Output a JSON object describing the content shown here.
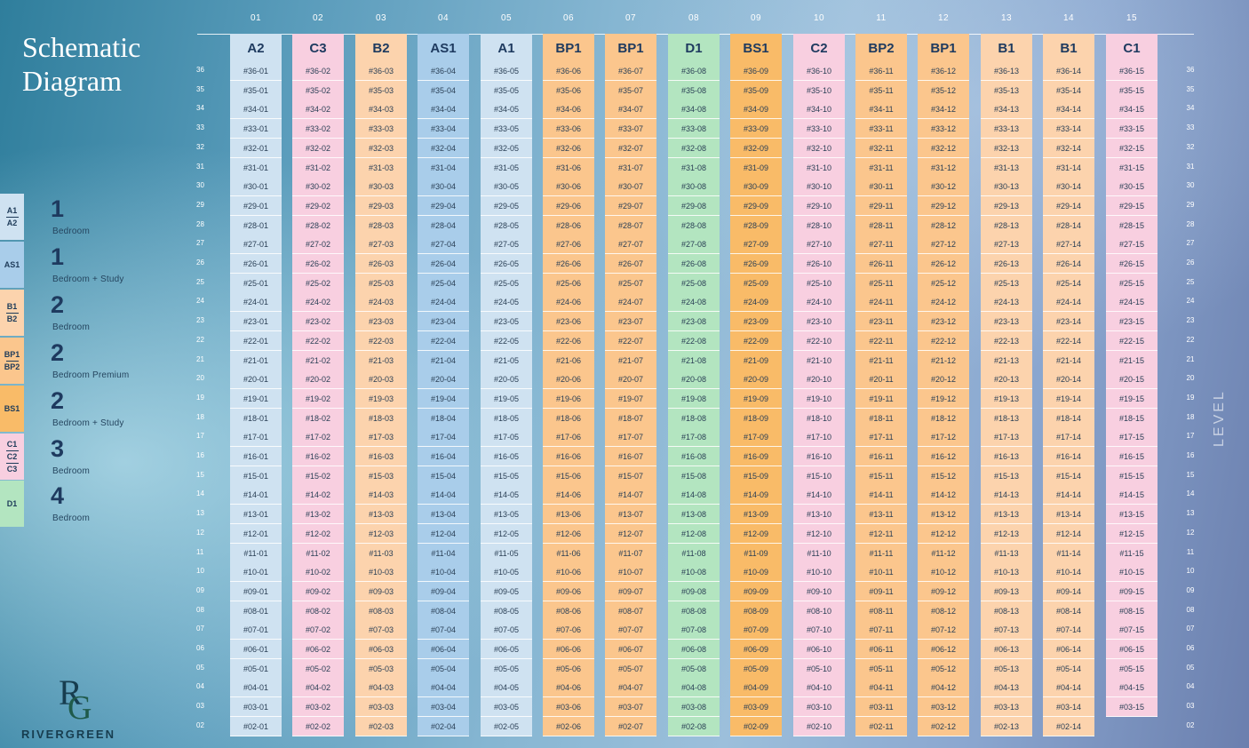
{
  "title": {
    "line1": "Schematic",
    "line2": "Diagram"
  },
  "colors": {
    "A": "#cfe2f1",
    "AS": "#a9cdea",
    "B": "#fcd3ad",
    "BP": "#fbc68d",
    "BS": "#f9bb68",
    "C": "#f8cfe0",
    "D": "#b3e5c0"
  },
  "legend": [
    {
      "codes": [
        "A1",
        "A2"
      ],
      "group": "A",
      "count": "1",
      "desc": "Bedroom"
    },
    {
      "codes": [
        "AS1"
      ],
      "group": "AS",
      "count": "1",
      "desc": "Bedroom + Study"
    },
    {
      "codes": [
        "B1",
        "B2"
      ],
      "group": "B",
      "count": "2",
      "desc": "Bedroom"
    },
    {
      "codes": [
        "BP1",
        "BP2"
      ],
      "group": "BP",
      "count": "2",
      "desc": "Bedroom Premium"
    },
    {
      "codes": [
        "BS1"
      ],
      "group": "BS",
      "count": "2",
      "desc": "Bedroom + Study"
    },
    {
      "codes": [
        "C1",
        "C2",
        "C3"
      ],
      "group": "C",
      "count": "3",
      "desc": "Bedroom"
    },
    {
      "codes": [
        "D1"
      ],
      "group": "D",
      "count": "4",
      "desc": "Bedroom"
    }
  ],
  "columns": [
    {
      "stack": "01",
      "type": "A2",
      "group": "A",
      "units": [
        "#36-01",
        "#35-01",
        "#34-01",
        "#33-01",
        "#32-01",
        "#31-01",
        "#30-01",
        "#29-01",
        "#28-01",
        "#27-01",
        "#26-01",
        "#25-01",
        "#24-01",
        "#23-01",
        "#22-01",
        "#21-01",
        "#20-01",
        "#19-01",
        "#18-01",
        "#17-01",
        "#16-01",
        "#15-01",
        "#14-01",
        "#13-01",
        "#12-01",
        "#11-01",
        "#10-01",
        "#09-01",
        "#08-01",
        "#07-01",
        "#06-01",
        "#05-01",
        "#04-01",
        "#03-01",
        "#02-01"
      ]
    },
    {
      "stack": "02",
      "type": "C3",
      "group": "C",
      "units": [
        "#36-02",
        "#35-02",
        "#34-02",
        "#33-02",
        "#32-02",
        "#31-02",
        "#30-02",
        "#29-02",
        "#28-02",
        "#27-02",
        "#26-02",
        "#25-02",
        "#24-02",
        "#23-02",
        "#22-02",
        "#21-02",
        "#20-02",
        "#19-02",
        "#18-02",
        "#17-02",
        "#16-02",
        "#15-02",
        "#14-02",
        "#13-02",
        "#12-02",
        "#11-02",
        "#10-02",
        "#09-02",
        "#08-02",
        "#07-02",
        "#06-02",
        "#05-02",
        "#04-02",
        "#03-02",
        "#02-02"
      ]
    },
    {
      "stack": "03",
      "type": "B2",
      "group": "B",
      "units": [
        "#36-03",
        "#35-03",
        "#34-03",
        "#33-03",
        "#32-03",
        "#31-03",
        "#30-03",
        "#29-03",
        "#28-03",
        "#27-03",
        "#26-03",
        "#25-03",
        "#24-03",
        "#23-03",
        "#22-03",
        "#21-03",
        "#20-03",
        "#19-03",
        "#18-03",
        "#17-03",
        "#16-03",
        "#15-03",
        "#14-03",
        "#13-03",
        "#12-03",
        "#11-03",
        "#10-03",
        "#09-03",
        "#08-03",
        "#07-03",
        "#06-03",
        "#05-03",
        "#04-03",
        "#03-03",
        "#02-03"
      ]
    },
    {
      "stack": "04",
      "type": "AS1",
      "group": "AS",
      "units": [
        "#36-04",
        "#35-04",
        "#34-04",
        "#33-04",
        "#32-04",
        "#31-04",
        "#30-04",
        "#29-04",
        "#28-04",
        "#27-04",
        "#26-04",
        "#25-04",
        "#24-04",
        "#23-04",
        "#22-04",
        "#21-04",
        "#20-04",
        "#19-04",
        "#18-04",
        "#17-04",
        "#16-04",
        "#15-04",
        "#14-04",
        "#13-04",
        "#12-04",
        "#11-04",
        "#10-04",
        "#09-04",
        "#08-04",
        "#07-04",
        "#06-04",
        "#05-04",
        "#04-04",
        "#03-04",
        "#02-04"
      ]
    },
    {
      "stack": "05",
      "type": "A1",
      "group": "A",
      "units": [
        "#36-05",
        "#35-05",
        "#34-05",
        "#33-05",
        "#32-05",
        "#31-05",
        "#30-05",
        "#29-05",
        "#28-05",
        "#27-05",
        "#26-05",
        "#25-05",
        "#24-05",
        "#23-05",
        "#22-05",
        "#21-05",
        "#20-05",
        "#19-05",
        "#18-05",
        "#17-05",
        "#16-05",
        "#15-05",
        "#14-05",
        "#13-05",
        "#12-05",
        "#11-05",
        "#10-05",
        "#09-05",
        "#08-05",
        "#07-05",
        "#06-05",
        "#05-05",
        "#04-05",
        "#03-05",
        "#02-05"
      ]
    },
    {
      "stack": "06",
      "type": "BP1",
      "group": "BP",
      "units": [
        "#36-06",
        "#35-06",
        "#34-06",
        "#33-06",
        "#32-06",
        "#31-06",
        "#30-06",
        "#29-06",
        "#28-06",
        "#27-06",
        "#26-06",
        "#25-06",
        "#24-06",
        "#23-06",
        "#22-06",
        "#21-06",
        "#20-06",
        "#19-06",
        "#18-06",
        "#17-06",
        "#16-06",
        "#15-06",
        "#14-06",
        "#13-06",
        "#12-06",
        "#11-06",
        "#10-06",
        "#09-06",
        "#08-06",
        "#07-06",
        "#06-06",
        "#05-06",
        "#04-06",
        "#03-06",
        "#02-06"
      ]
    },
    {
      "stack": "07",
      "type": "BP1",
      "group": "BP",
      "units": [
        "#36-07",
        "#35-07",
        "#34-07",
        "#33-07",
        "#32-07",
        "#31-07",
        "#30-07",
        "#29-07",
        "#28-07",
        "#27-07",
        "#26-07",
        "#25-07",
        "#24-07",
        "#23-07",
        "#22-07",
        "#21-07",
        "#20-07",
        "#19-07",
        "#18-07",
        "#17-07",
        "#16-07",
        "#15-07",
        "#14-07",
        "#13-07",
        "#12-07",
        "#11-07",
        "#10-07",
        "#09-07",
        "#08-07",
        "#07-07",
        "#06-07",
        "#05-07",
        "#04-07",
        "#03-07",
        "#02-07"
      ]
    },
    {
      "stack": "08",
      "type": "D1",
      "group": "D",
      "units": [
        "#36-08",
        "#35-08",
        "#34-08",
        "#33-08",
        "#32-08",
        "#31-08",
        "#30-08",
        "#29-08",
        "#28-08",
        "#27-08",
        "#26-08",
        "#25-08",
        "#24-08",
        "#23-08",
        "#22-08",
        "#21-08",
        "#20-08",
        "#19-08",
        "#18-08",
        "#17-08",
        "#16-08",
        "#15-08",
        "#14-08",
        "#13-08",
        "#12-08",
        "#11-08",
        "#10-08",
        "#09-08",
        "#08-08",
        "#07-08",
        "#06-08",
        "#05-08",
        "#04-08",
        "#03-08",
        "#02-08"
      ]
    },
    {
      "stack": "09",
      "type": "BS1",
      "group": "BS",
      "units": [
        "#36-09",
        "#35-09",
        "#34-09",
        "#33-09",
        "#32-09",
        "#31-09",
        "#30-09",
        "#29-09",
        "#28-09",
        "#27-09",
        "#26-09",
        "#25-09",
        "#24-09",
        "#23-09",
        "#22-09",
        "#21-09",
        "#20-09",
        "#19-09",
        "#18-09",
        "#17-09",
        "#16-09",
        "#15-09",
        "#14-09",
        "#13-09",
        "#12-09",
        "#11-09",
        "#10-09",
        "#09-09",
        "#08-09",
        "#07-09",
        "#06-09",
        "#05-09",
        "#04-09",
        "#03-09",
        "#02-09"
      ]
    },
    {
      "stack": "10",
      "type": "C2",
      "group": "C",
      "units": [
        "#36-10",
        "#35-10",
        "#34-10",
        "#33-10",
        "#32-10",
        "#31-10",
        "#30-10",
        "#29-10",
        "#28-10",
        "#27-10",
        "#26-10",
        "#25-10",
        "#24-10",
        "#23-10",
        "#22-10",
        "#21-10",
        "#20-10",
        "#19-10",
        "#18-10",
        "#17-10",
        "#16-10",
        "#15-10",
        "#14-10",
        "#13-10",
        "#12-10",
        "#11-10",
        "#10-10",
        "#09-10",
        "#08-10",
        "#07-10",
        "#06-10",
        "#05-10",
        "#04-10",
        "#03-10",
        "#02-10"
      ]
    },
    {
      "stack": "11",
      "type": "BP2",
      "group": "BP",
      "units": [
        "#36-11",
        "#35-11",
        "#34-11",
        "#33-11",
        "#32-11",
        "#31-11",
        "#30-11",
        "#29-11",
        "#28-11",
        "#27-11",
        "#26-11",
        "#25-11",
        "#24-11",
        "#23-11",
        "#22-11",
        "#21-11",
        "#20-11",
        "#19-11",
        "#18-11",
        "#17-11",
        "#16-11",
        "#15-11",
        "#14-11",
        "#13-11",
        "#12-11",
        "#11-11",
        "#10-11",
        "#09-11",
        "#08-11",
        "#07-11",
        "#06-11",
        "#05-11",
        "#04-11",
        "#03-11",
        "#02-11"
      ]
    },
    {
      "stack": "12",
      "type": "BP1",
      "group": "BP",
      "units": [
        "#36-12",
        "#35-12",
        "#34-12",
        "#33-12",
        "#32-12",
        "#31-12",
        "#30-12",
        "#29-12",
        "#28-12",
        "#27-12",
        "#26-12",
        "#25-12",
        "#24-12",
        "#23-12",
        "#22-12",
        "#21-12",
        "#20-12",
        "#19-12",
        "#18-12",
        "#17-12",
        "#16-12",
        "#15-12",
        "#14-12",
        "#13-12",
        "#12-12",
        "#11-12",
        "#10-12",
        "#09-12",
        "#08-12",
        "#07-12",
        "#06-12",
        "#05-12",
        "#04-12",
        "#03-12",
        "#02-12"
      ]
    },
    {
      "stack": "13",
      "type": "B1",
      "group": "B",
      "units": [
        "#36-13",
        "#35-13",
        "#34-13",
        "#33-13",
        "#32-13",
        "#31-13",
        "#30-13",
        "#29-13",
        "#28-13",
        "#27-13",
        "#26-13",
        "#25-13",
        "#24-13",
        "#23-13",
        "#22-13",
        "#21-13",
        "#20-13",
        "#19-13",
        "#18-13",
        "#17-13",
        "#16-13",
        "#15-13",
        "#14-13",
        "#13-13",
        "#12-13",
        "#11-13",
        "#10-13",
        "#09-13",
        "#08-13",
        "#07-13",
        "#06-13",
        "#05-13",
        "#04-13",
        "#03-13",
        "#02-13"
      ]
    },
    {
      "stack": "14",
      "type": "B1",
      "group": "B",
      "units": [
        "#36-14",
        "#35-14",
        "#34-14",
        "#33-14",
        "#32-14",
        "#31-14",
        "#30-14",
        "#29-14",
        "#28-14",
        "#27-14",
        "#26-14",
        "#25-14",
        "#24-14",
        "#23-14",
        "#22-14",
        "#21-14",
        "#20-14",
        "#19-14",
        "#18-14",
        "#17-14",
        "#16-14",
        "#15-14",
        "#14-14",
        "#13-14",
        "#12-14",
        "#11-14",
        "#10-14",
        "#09-14",
        "#08-14",
        "#07-14",
        "#06-14",
        "#05-14",
        "#04-14",
        "#03-14",
        "#02-14"
      ]
    },
    {
      "stack": "15",
      "type": "C1",
      "group": "C",
      "units": [
        "#36-15",
        "#35-15",
        "#34-15",
        "#33-15",
        "#32-15",
        "#31-15",
        "#30-15",
        "#29-15",
        "#28-15",
        "#27-15",
        "#26-15",
        "#25-15",
        "#24-15",
        "#23-15",
        "#22-15",
        "#21-15",
        "#20-15",
        "#19-15",
        "#18-15",
        "#17-15",
        "#16-15",
        "#15-15",
        "#14-15",
        "#13-15",
        "#12-15",
        "#11-15",
        "#10-15",
        "#09-15",
        "#08-15",
        "#07-15",
        "#06-15",
        "#05-15",
        "#04-15",
        "#03-15"
      ]
    }
  ],
  "levels": [
    "36",
    "35",
    "34",
    "33",
    "32",
    "31",
    "30",
    "29",
    "28",
    "27",
    "26",
    "25",
    "24",
    "23",
    "22",
    "21",
    "20",
    "19",
    "18",
    "17",
    "16",
    "15",
    "14",
    "13",
    "12",
    "11",
    "10",
    "09",
    "08",
    "07",
    "06",
    "05",
    "04",
    "03",
    "02"
  ],
  "level_title": "LEVEL",
  "brand": {
    "monogram": "RG",
    "name": "RIVERGREEN"
  }
}
